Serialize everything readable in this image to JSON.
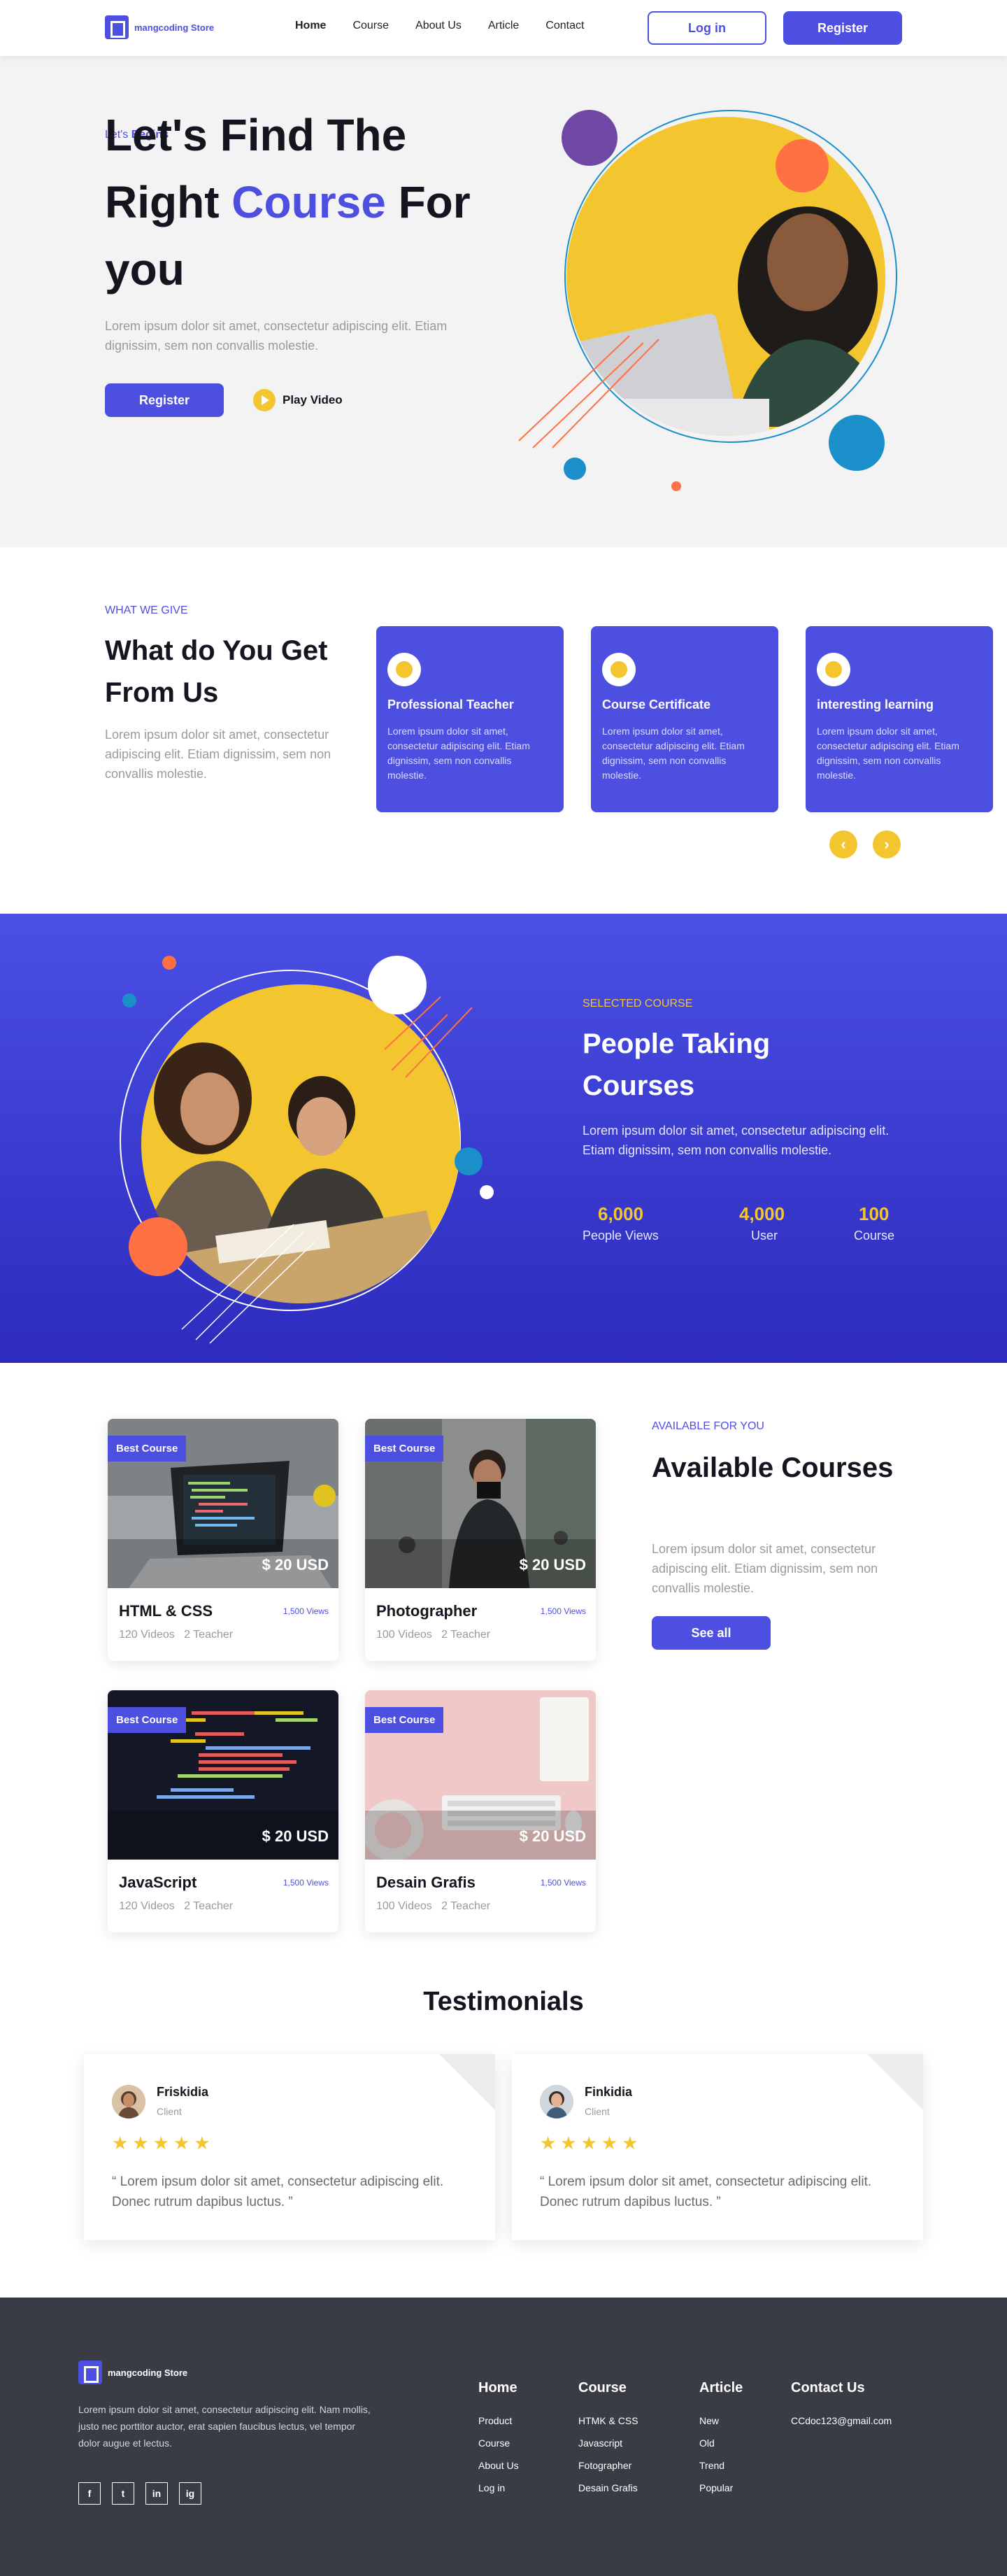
{
  "header": {
    "logo_text": "mangcoding Store",
    "nav": [
      "Home",
      "Course",
      "About Us",
      "Article",
      "Contact"
    ],
    "login_label": "Log in",
    "register_label": "Register"
  },
  "hero": {
    "eyebrow_prefix": "Let's",
    "eyebrow_highlight": "Begins",
    "title_line1": "Let's Find The",
    "title_line2_a": "Right",
    "title_line2_hl": "Course",
    "title_line2_b": "For",
    "title_line3": "you",
    "description": "Lorem ipsum dolor sit amet, consectetur adipiscing elit. Etiam dignissim, sem non convallis molestie.",
    "register_label": "Register",
    "play_label": "Play Video"
  },
  "give": {
    "eyebrow": "WHAT WE GIVE",
    "title": "What do You Get From Us",
    "description": "Lorem ipsum dolor sit amet, consectetur adipiscing elit. Etiam dignissim, sem non convallis molestie.",
    "cards": [
      {
        "title": "Professional Teacher",
        "text": "Lorem ipsum dolor sit amet, consectetur adipiscing elit. Etiam dignissim, sem non convallis molestie.",
        "icon": "teacher-icon"
      },
      {
        "title": "Course Certificate",
        "text": "Lorem ipsum dolor sit amet, consectetur adipiscing elit. Etiam dignissim, sem non convallis molestie.",
        "icon": "certificate-icon"
      },
      {
        "title": "interesting learning",
        "text": "Lorem ipsum dolor sit amet, consectetur adipiscing elit. Etiam dignissim, sem non convallis molestie.",
        "icon": "learning-icon"
      }
    ],
    "prev_glyph": "‹",
    "next_glyph": "›"
  },
  "selected": {
    "eyebrow": "SELECTED COURSE",
    "title": "People Taking Courses",
    "description": "Lorem ipsum dolor sit amet, consectetur adipiscing elit. Etiam dignissim, sem non convallis molestie.",
    "stats": [
      {
        "value": "6,000",
        "label": "People Views"
      },
      {
        "value": "4,000",
        "label": "User"
      },
      {
        "value": "100",
        "label": "Course"
      }
    ]
  },
  "courses": {
    "eyebrow": "AVAILABLE FOR YOU",
    "title": "Available Courses",
    "description": "Lorem ipsum dolor sit amet, consectetur adipiscing elit. Etiam dignissim, sem non convallis molestie.",
    "see_all_label": "See all",
    "badge": "Best Course",
    "items": [
      {
        "name": "HTML & CSS",
        "views": "1,500 Views",
        "videos": "120 Videos",
        "teachers": "2 Teacher",
        "price": "$ 20 USD"
      },
      {
        "name": "Photographer",
        "views": "1,500 Views",
        "videos": "100 Videos",
        "teachers": "2 Teacher",
        "price": "$ 20 USD"
      },
      {
        "name": "JavaScript",
        "views": "1,500 Views",
        "videos": "120 Videos",
        "teachers": "2 Teacher",
        "price": "$ 20 USD"
      },
      {
        "name": "Desain Grafis",
        "views": "1,500 Views",
        "videos": "100 Videos",
        "teachers": "2 Teacher",
        "price": "$ 20 USD"
      }
    ]
  },
  "testimonials": {
    "title": "Testimonials",
    "items": [
      {
        "name": "Friskidia",
        "role": "Client",
        "stars": "★★★★★",
        "quote": "“ Lorem ipsum dolor sit amet, consectetur adipiscing elit. Donec rutrum dapibus luctus. ”"
      },
      {
        "name": "Finkidia",
        "role": "Client",
        "stars": "★★★★★",
        "quote": "“ Lorem ipsum dolor sit amet, consectetur adipiscing elit. Donec rutrum dapibus luctus. ”"
      }
    ]
  },
  "footer": {
    "logo_text": "mangcoding Store",
    "description": "Lorem ipsum dolor sit amet, consectetur adipiscing elit. Nam mollis, justo nec porttitor auctor, erat sapien faucibus lectus, vel tempor dolor augue et lectus.",
    "social": [
      "f",
      "t",
      "in",
      "ig"
    ],
    "columns": [
      {
        "title": "Home",
        "links": [
          "Product",
          "Course",
          "About Us",
          "Log in"
        ]
      },
      {
        "title": "Course",
        "links": [
          "HTMK & CSS",
          "Javascript",
          "Fotographer",
          "Desain Grafis"
        ]
      },
      {
        "title": "Article",
        "links": [
          "New",
          "Old",
          "Trend",
          "Popular"
        ]
      },
      {
        "title": "Contact Us",
        "links": [
          "CCdoc123@gmail.com"
        ]
      }
    ]
  },
  "colors": {
    "primary": "#4d4fe0",
    "accent": "#f3c62f",
    "dark": "#3a3c45",
    "orange": "#ff7043",
    "teal": "#1a8fc9"
  }
}
